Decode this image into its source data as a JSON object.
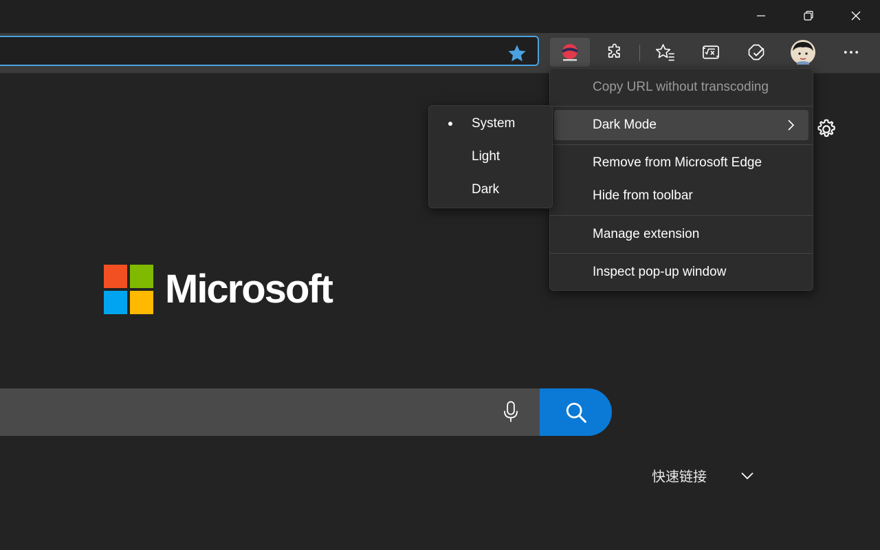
{
  "window_controls": {
    "minimize": "minimize-icon",
    "restore": "restore-icon",
    "close": "close-icon"
  },
  "toolbar": {
    "favorite_star": "star-filled-icon",
    "extension_active": "dark-reader-extension-icon",
    "extensions": "puzzle-icon",
    "favorites": "favorites-icon",
    "math_solver": "math-solver-icon",
    "performance": "performance-icon",
    "profile": "avatar",
    "more": "ellipsis-icon"
  },
  "page": {
    "logo_text": "Microsoft",
    "quick_links": "快速链接",
    "brand_colors": {
      "red": "#f25022",
      "green": "#7fba00",
      "blue": "#00a4ef",
      "yellow": "#ffb900"
    },
    "search_button_color": "#0a7ad6"
  },
  "context_menu": {
    "items": [
      {
        "label": "Copy URL without transcoding",
        "disabled": true
      },
      {
        "label": "Dark Mode",
        "has_submenu": true,
        "hovered": true
      },
      {
        "label": "Remove from Microsoft Edge"
      },
      {
        "label": "Hide from toolbar"
      },
      {
        "label": "Manage extension"
      },
      {
        "label": "Inspect pop-up window"
      }
    ]
  },
  "submenu": {
    "items": [
      {
        "label": "System",
        "selected": true
      },
      {
        "label": "Light"
      },
      {
        "label": "Dark"
      }
    ]
  }
}
